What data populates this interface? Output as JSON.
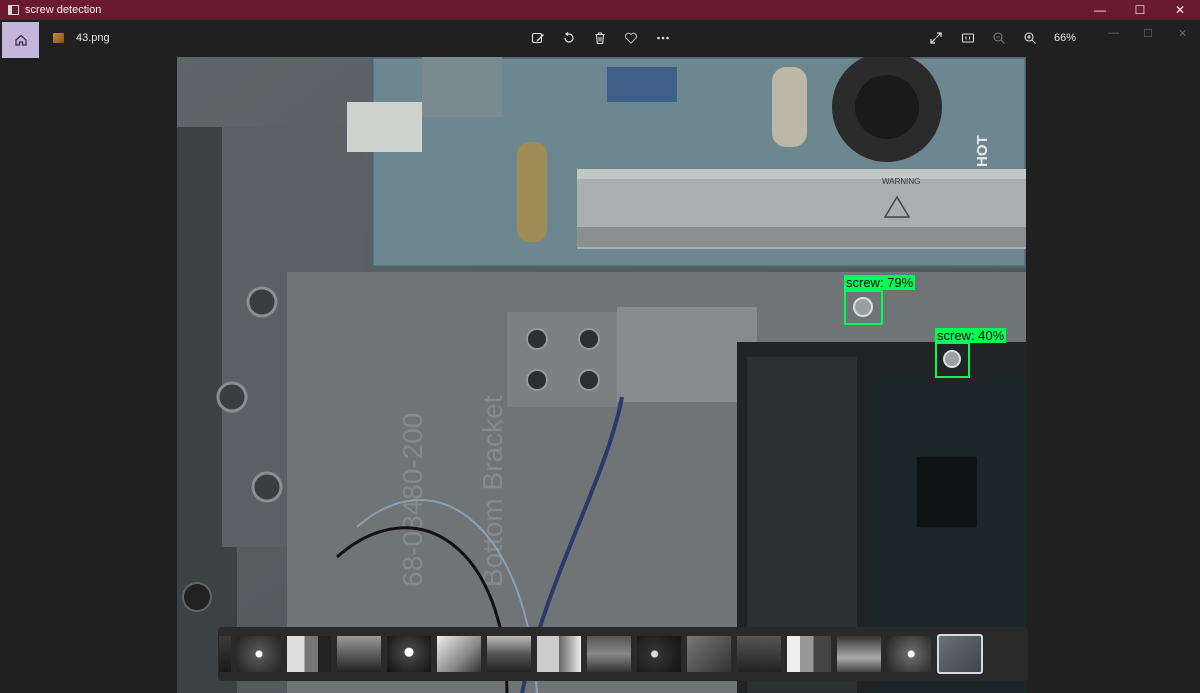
{
  "window": {
    "title": "screw detection",
    "controls": {
      "minimize": "—",
      "maximize": "☐",
      "close": "✕"
    }
  },
  "toolbar": {
    "file_name": "43.png",
    "zoom": "66%",
    "icons": [
      "home-icon",
      "image-file-icon",
      "edit-icon",
      "rotate-icon",
      "delete-icon",
      "favorite-icon",
      "more-icon",
      "fullscreen-icon",
      "actual-size-icon",
      "zoom-out-icon",
      "zoom-in-icon"
    ]
  },
  "photo": {
    "printed_text": {
      "warning": "WARNING",
      "hot": "HOT",
      "part_number": "68-08480-200",
      "bracket": "Bottom Bracket"
    },
    "detections": [
      {
        "label": "screw: 79%"
      },
      {
        "label": "screw: 40%"
      }
    ]
  },
  "filmstrip": {
    "thumbnail_count": 15,
    "selected_index": 14
  },
  "colors": {
    "titlebar": "#6b1a2d",
    "detection_box": "#00ff55",
    "home_button": "#c4b5dc",
    "background": "#202020"
  }
}
